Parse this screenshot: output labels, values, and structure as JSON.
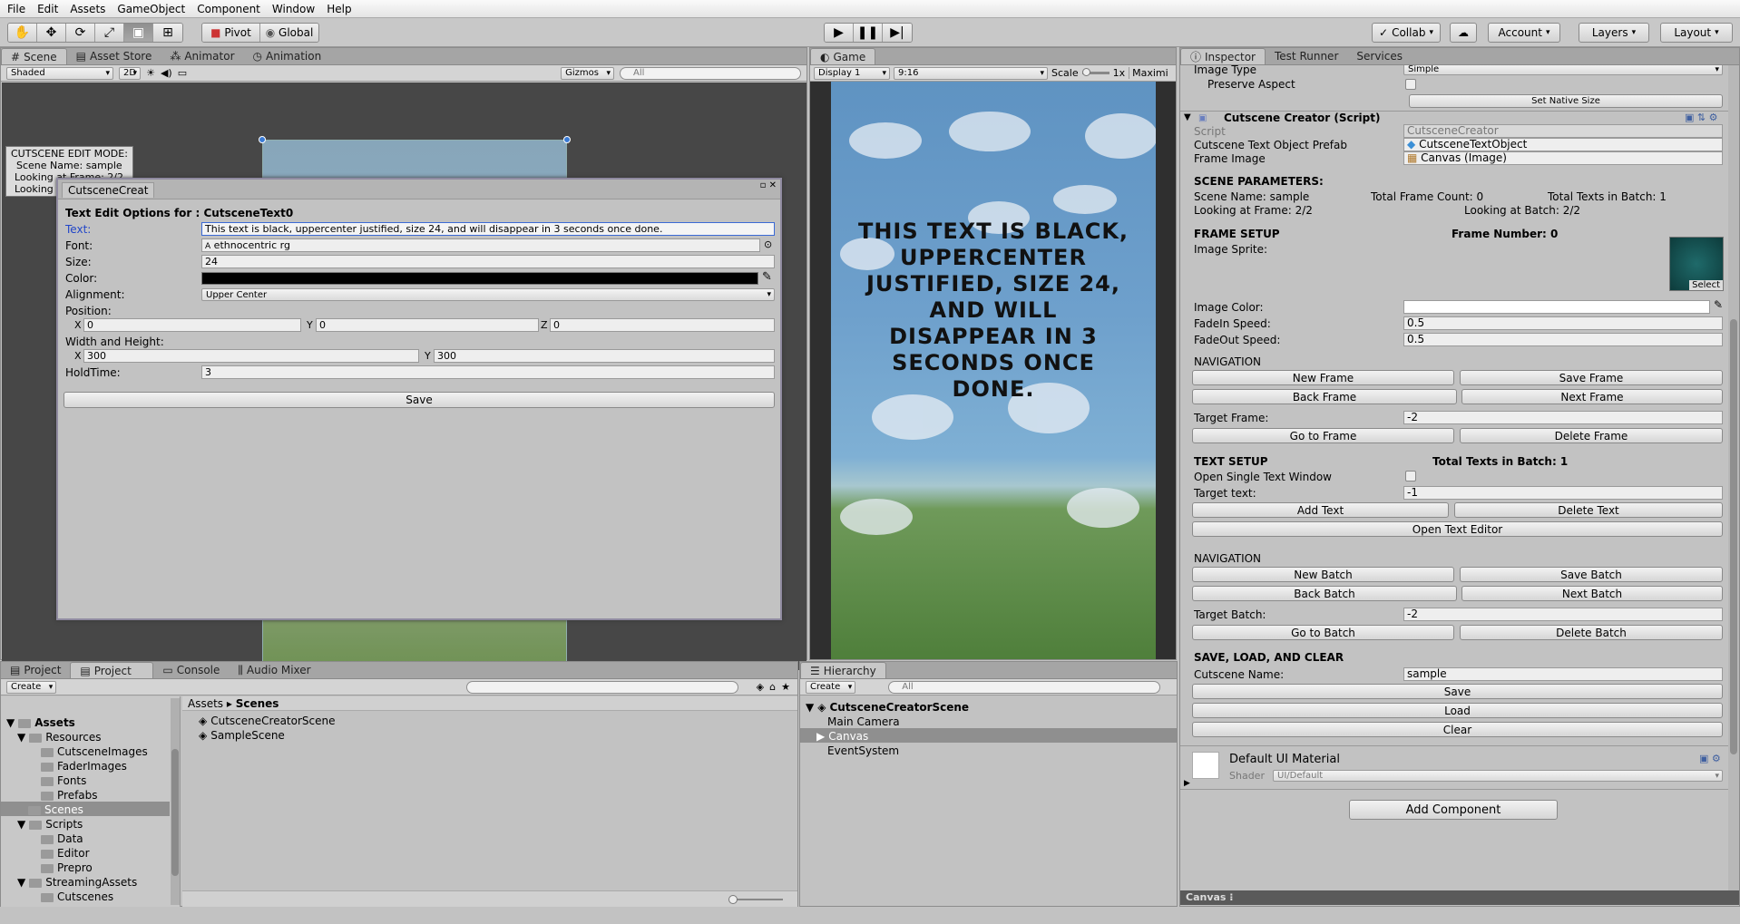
{
  "menu": [
    "File",
    "Edit",
    "Assets",
    "GameObject",
    "Component",
    "Window",
    "Help"
  ],
  "toolbar": {
    "pivot": "Pivot",
    "global": "Global",
    "collab": "Collab",
    "account": "Account",
    "layers": "Layers",
    "layout": "Layout"
  },
  "scene": {
    "tabs": [
      "Scene",
      "Asset Store",
      "Animator",
      "Animation"
    ],
    "shading": "Shaded",
    "mode2d": "2D",
    "gizmos": "Gizmos",
    "search_placeholder": "All",
    "overlay": [
      "CUTSCENE EDIT MODE:",
      "Scene Name: sample",
      "Looking at Frame: 2/2",
      "Looking at Batch: 2/2"
    ]
  },
  "editor_window": {
    "tab": "CutsceneCreat",
    "title": "Text Edit Options for : CutsceneText0",
    "text_label": "Text:",
    "text_value": "This text is black, uppercenter justified, size 24, and will disappear in 3 seconds once done.",
    "font_label": "Font:",
    "font_value": "ethnocentric rg",
    "size_label": "Size:",
    "size_value": "24",
    "color_label": "Color:",
    "alignment_label": "Alignment:",
    "alignment_value": "Upper Center",
    "position_label": "Position:",
    "pos_x": "0",
    "pos_y": "0",
    "pos_z": "0",
    "wh_label": "Width and Height:",
    "w": "300",
    "h": "300",
    "hold_label": "HoldTime:",
    "hold_value": "3",
    "save": "Save",
    "x": "X",
    "y": "Y",
    "z": "Z"
  },
  "game": {
    "tab": "Game",
    "display": "Display 1",
    "aspect": "9:16",
    "scale_label": "Scale",
    "scale_value": "1x",
    "maxi": "Maximi",
    "text": "THIS TEXT IS BLACK, UPPERCENTER JUSTIFIED, SIZE 24, AND WILL DISAPPEAR IN 3 SECONDS ONCE DONE."
  },
  "inspector": {
    "tabs": [
      "Inspector",
      "Test Runner",
      "Services"
    ],
    "image_type_label": "Image Type",
    "image_type_value": "Simple",
    "preserve_aspect": "Preserve Aspect",
    "set_native_size": "Set Native Size",
    "component_title": "Cutscene Creator (Script)",
    "script_label": "Script",
    "script_value": "CutsceneCreator",
    "prefab_label": "Cutscene Text Object Prefab",
    "prefab_value": "CutsceneTextObject",
    "frame_image_label": "Frame Image",
    "frame_image_value": "Canvas (Image)",
    "scene_params": "SCENE PARAMETERS:",
    "scene_name": "Scene Name: sample",
    "total_frame_count": "Total Frame Count: 0",
    "total_texts_batch": "Total Texts in Batch: 1",
    "looking_frame": "Looking at Frame: 2/2",
    "looking_batch": "Looking at Batch: 2/2",
    "frame_setup": "FRAME SETUP",
    "frame_number": "Frame Number: 0",
    "image_sprite": "Image Sprite:",
    "select": "Select",
    "image_color": "Image Color:",
    "fadein_label": "FadeIn Speed:",
    "fadein_value": "0.5",
    "fadeout_label": "FadeOut Speed:",
    "fadeout_value": "0.5",
    "navigation": "NAVIGATION",
    "new_frame": "New Frame",
    "save_frame": "Save Frame",
    "back_frame": "Back Frame",
    "next_frame": "Next Frame",
    "target_frame_label": "Target Frame:",
    "target_frame_value": "-2",
    "go_to_frame": "Go to Frame",
    "delete_frame": "Delete Frame",
    "text_setup": "TEXT SETUP",
    "total_texts": "Total Texts in Batch: 1",
    "open_single": "Open Single Text Window",
    "target_text_label": "Target text:",
    "target_text_value": "-1",
    "add_text": "Add Text",
    "delete_text": "Delete Text",
    "open_text_editor": "Open Text Editor",
    "navigation2": "NAVIGATION",
    "new_batch": "New Batch",
    "save_batch": "Save Batch",
    "back_batch": "Back Batch",
    "next_batch": "Next Batch",
    "target_batch_label": "Target Batch:",
    "target_batch_value": "-2",
    "go_to_batch": "Go to Batch",
    "delete_batch": "Delete Batch",
    "save_load_clear": "SAVE, LOAD, AND CLEAR",
    "cutscene_name_label": "Cutscene Name:",
    "cutscene_name_value": "sample",
    "save": "Save",
    "load": "Load",
    "clear": "Clear",
    "material": "Default UI Material",
    "shader_label": "Shader",
    "shader_value": "UI/Default",
    "add_component": "Add Component",
    "footer": "Canvas"
  },
  "project": {
    "tabs": [
      "Project",
      "Project",
      "Console",
      "Audio Mixer"
    ],
    "create": "Create",
    "tree": [
      "Assets",
      "Resources",
      "CutsceneImages",
      "FaderImages",
      "Fonts",
      "Prefabs",
      "Scenes",
      "Scripts",
      "Data",
      "Editor",
      "Prepro",
      "StreamingAssets",
      "Cutscenes"
    ],
    "breadcrumb": [
      "Assets",
      "Scenes"
    ],
    "files": [
      "CutsceneCreatorScene",
      "SampleScene"
    ]
  },
  "hierarchy": {
    "tab": "Hierarchy",
    "create": "Create",
    "search_placeholder": "All",
    "root": "CutsceneCreatorScene",
    "items": [
      "Main Camera",
      "Canvas",
      "EventSystem"
    ]
  }
}
